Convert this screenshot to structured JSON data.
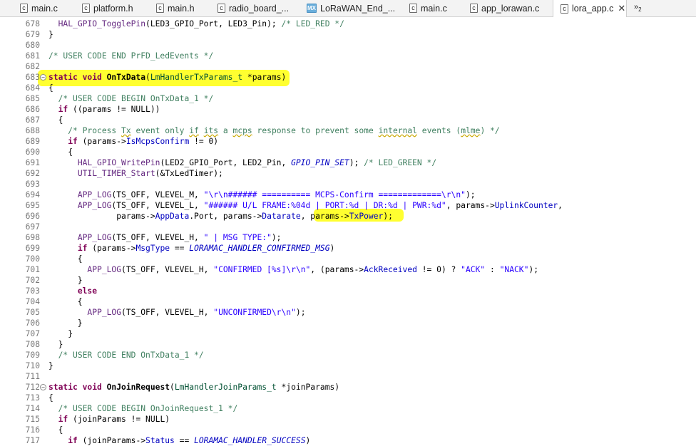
{
  "tabs": [
    {
      "label": "main.c",
      "icon": "c"
    },
    {
      "label": "platform.h",
      "icon": "c"
    },
    {
      "label": "main.h",
      "icon": "c"
    },
    {
      "label": "radio_board_...",
      "icon": "c"
    },
    {
      "label": "LoRaWAN_End_...",
      "icon": "MX"
    },
    {
      "label": "main.c",
      "icon": "c"
    },
    {
      "label": "app_lorawan.c",
      "icon": "c"
    },
    {
      "label": "lora_app.c",
      "icon": "c",
      "close": "✕"
    }
  ],
  "overflow": {
    "label": "»",
    "count": "2"
  },
  "code_lines": [
    {
      "n": "678",
      "segs": [
        [
          "",
          "  "
        ],
        [
          "mc",
          "HAL_GPIO_TogglePin"
        ],
        [
          "",
          "(LED3_GPIO_Port, LED3_Pin); "
        ],
        [
          "cm",
          "/* LED_RED */"
        ]
      ]
    },
    {
      "n": "679",
      "segs": [
        [
          "",
          "}"
        ]
      ]
    },
    {
      "n": "680",
      "segs": []
    },
    {
      "n": "681",
      "segs": [
        [
          "cm",
          "/* USER CODE END PrFD_LedEvents */"
        ]
      ]
    },
    {
      "n": "682",
      "segs": []
    },
    {
      "n": "683",
      "fold": "⊖",
      "segs": [
        [
          "kw",
          "static void "
        ],
        [
          "fn",
          "OnTxData"
        ],
        [
          "",
          "("
        ],
        [
          "ty",
          "LmHandlerTxParams_t"
        ],
        [
          "",
          " *params)"
        ]
      ]
    },
    {
      "n": "684",
      "segs": [
        [
          "",
          "{"
        ]
      ]
    },
    {
      "n": "685",
      "segs": [
        [
          "",
          "  "
        ],
        [
          "cm",
          "/* USER CODE BEGIN OnTxData_1 */"
        ]
      ]
    },
    {
      "n": "686",
      "segs": [
        [
          "",
          "  "
        ],
        [
          "kw",
          "if"
        ],
        [
          "",
          " ((params != NULL))"
        ]
      ]
    },
    {
      "n": "687",
      "segs": [
        [
          "",
          "  {"
        ]
      ]
    },
    {
      "n": "688",
      "segs": [
        [
          "",
          "    "
        ],
        [
          "cm",
          "/* Process "
        ],
        [
          "cm sq",
          "Tx"
        ],
        [
          "cm",
          " event only "
        ],
        [
          "cm sq",
          "if"
        ],
        [
          "cm",
          " "
        ],
        [
          "cm sq",
          "its"
        ],
        [
          "cm",
          " a "
        ],
        [
          "cm sq",
          "mcps"
        ],
        [
          "cm",
          " response to prevent some "
        ],
        [
          "cm sq",
          "internal"
        ],
        [
          "cm",
          " events ("
        ],
        [
          "cm sq",
          "mlme"
        ],
        [
          "cm",
          ") */"
        ]
      ]
    },
    {
      "n": "689",
      "segs": [
        [
          "",
          "    "
        ],
        [
          "kw",
          "if"
        ],
        [
          "",
          " (params->"
        ],
        [
          "fl",
          "IsMcpsConfirm"
        ],
        [
          "",
          " != 0)"
        ]
      ]
    },
    {
      "n": "690",
      "segs": [
        [
          "",
          "    {"
        ]
      ]
    },
    {
      "n": "691",
      "segs": [
        [
          "",
          "      "
        ],
        [
          "mc",
          "HAL_GPIO_WritePin"
        ],
        [
          "",
          "(LED2_GPIO_Port, LED2_Pin, "
        ],
        [
          "it",
          "GPIO_PIN_SET"
        ],
        [
          "",
          "); "
        ],
        [
          "cm",
          "/* LED_GREEN */"
        ]
      ]
    },
    {
      "n": "692",
      "segs": [
        [
          "",
          "      "
        ],
        [
          "mc",
          "UTIL_TIMER_Start"
        ],
        [
          "",
          "(&TxLedTimer);"
        ]
      ]
    },
    {
      "n": "693",
      "segs": []
    },
    {
      "n": "694",
      "segs": [
        [
          "",
          "      "
        ],
        [
          "mc",
          "APP_LOG"
        ],
        [
          "",
          "(TS_OFF, VLEVEL_M, "
        ],
        [
          "st",
          "\"\\r\\n###### ========== MCPS-Confirm =============\\r\\n\""
        ],
        [
          "",
          ");"
        ]
      ]
    },
    {
      "n": "695",
      "segs": [
        [
          "",
          "      "
        ],
        [
          "mc",
          "APP_LOG"
        ],
        [
          "",
          "(TS_OFF, VLEVEL_L, "
        ],
        [
          "st",
          "\"###### U/L FRAME:%04d | PORT:%d | DR:%d | PWR:%d\""
        ],
        [
          "",
          ", params->"
        ],
        [
          "fl",
          "UplinkCounter"
        ],
        [
          "",
          ","
        ]
      ]
    },
    {
      "n": "696",
      "segs": [
        [
          "",
          "              params->"
        ],
        [
          "fl",
          "AppData"
        ],
        [
          "",
          ".Port, params->"
        ],
        [
          "fl",
          "Datarate"
        ],
        [
          "",
          ", params->"
        ],
        [
          "fl",
          "TxPower"
        ],
        [
          "",
          ");"
        ]
      ]
    },
    {
      "n": "697",
      "segs": []
    },
    {
      "n": "698",
      "segs": [
        [
          "",
          "      "
        ],
        [
          "mc",
          "APP_LOG"
        ],
        [
          "",
          "(TS_OFF, VLEVEL_H, "
        ],
        [
          "st",
          "\" | MSG TYPE:\""
        ],
        [
          "",
          ");"
        ]
      ]
    },
    {
      "n": "699",
      "segs": [
        [
          "",
          "      "
        ],
        [
          "kw",
          "if"
        ],
        [
          "",
          " (params->"
        ],
        [
          "fl",
          "MsgType"
        ],
        [
          "",
          " == "
        ],
        [
          "it",
          "LORAMAC_HANDLER_CONFIRMED_MSG"
        ],
        [
          "",
          ")"
        ]
      ]
    },
    {
      "n": "700",
      "segs": [
        [
          "",
          "      {"
        ]
      ]
    },
    {
      "n": "701",
      "segs": [
        [
          "",
          "        "
        ],
        [
          "mc",
          "APP_LOG"
        ],
        [
          "",
          "(TS_OFF, VLEVEL_H, "
        ],
        [
          "st",
          "\"CONFIRMED [%s]\\r\\n\""
        ],
        [
          "",
          ", (params->"
        ],
        [
          "fl",
          "AckReceived"
        ],
        [
          "",
          " != 0) ? "
        ],
        [
          "st",
          "\"ACK\""
        ],
        [
          "",
          " : "
        ],
        [
          "st",
          "\"NACK\""
        ],
        [
          "",
          ");"
        ]
      ]
    },
    {
      "n": "702",
      "segs": [
        [
          "",
          "      }"
        ]
      ]
    },
    {
      "n": "703",
      "segs": [
        [
          "",
          "      "
        ],
        [
          "kw",
          "else"
        ]
      ]
    },
    {
      "n": "704",
      "segs": [
        [
          "",
          "      {"
        ]
      ]
    },
    {
      "n": "705",
      "segs": [
        [
          "",
          "        "
        ],
        [
          "mc",
          "APP_LOG"
        ],
        [
          "",
          "(TS_OFF, VLEVEL_H, "
        ],
        [
          "st",
          "\"UNCONFIRMED\\r\\n\""
        ],
        [
          "",
          ");"
        ]
      ]
    },
    {
      "n": "706",
      "segs": [
        [
          "",
          "      }"
        ]
      ]
    },
    {
      "n": "707",
      "segs": [
        [
          "",
          "    }"
        ]
      ]
    },
    {
      "n": "708",
      "segs": [
        [
          "",
          "  }"
        ]
      ]
    },
    {
      "n": "709",
      "segs": [
        [
          "",
          "  "
        ],
        [
          "cm",
          "/* USER CODE END OnTxData_1 */"
        ]
      ]
    },
    {
      "n": "710",
      "segs": [
        [
          "",
          "}"
        ]
      ]
    },
    {
      "n": "711",
      "segs": []
    },
    {
      "n": "712",
      "fold": "⊖",
      "segs": [
        [
          "kw",
          "static void "
        ],
        [
          "fn",
          "OnJoinRequest"
        ],
        [
          "",
          "("
        ],
        [
          "ty",
          "LmHandlerJoinParams_t"
        ],
        [
          "",
          " *joinParams)"
        ]
      ]
    },
    {
      "n": "713",
      "segs": [
        [
          "",
          "{"
        ]
      ]
    },
    {
      "n": "714",
      "segs": [
        [
          "",
          "  "
        ],
        [
          "cm",
          "/* USER CODE BEGIN OnJoinRequest_1 */"
        ]
      ]
    },
    {
      "n": "715",
      "segs": [
        [
          "",
          "  "
        ],
        [
          "kw",
          "if"
        ],
        [
          "",
          " (joinParams != NULL)"
        ]
      ]
    },
    {
      "n": "716",
      "segs": [
        [
          "",
          "  {"
        ]
      ]
    },
    {
      "n": "717",
      "segs": [
        [
          "",
          "    "
        ],
        [
          "kw",
          "if"
        ],
        [
          "",
          " (joinParams->"
        ],
        [
          "fl",
          "Status"
        ],
        [
          "",
          " == "
        ],
        [
          "it",
          "LORAMAC_HANDLER_SUCCESS"
        ],
        [
          "",
          ")"
        ]
      ]
    }
  ]
}
